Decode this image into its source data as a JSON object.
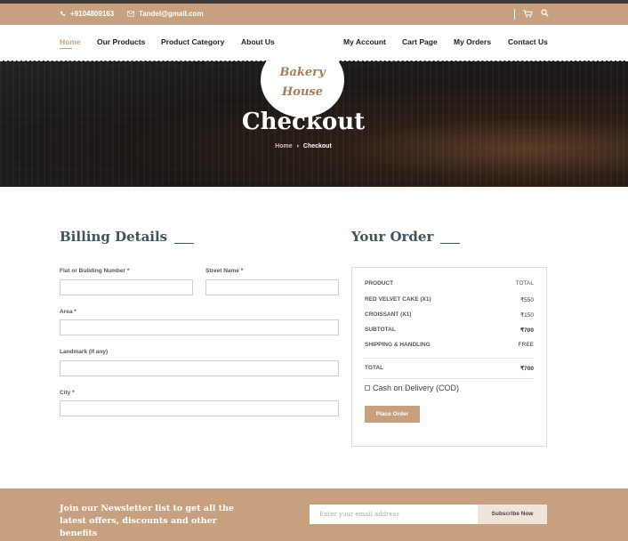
{
  "topbar": {
    "phone": "+9104809163",
    "email": "Tandel@gmail.com",
    "icons": [
      "phone-icon",
      "mail-icon",
      "cart-icon",
      "search-icon"
    ]
  },
  "nav": {
    "items": [
      "Home",
      "Our Products",
      "Product Category",
      "About Us",
      "My Account",
      "Cart Page",
      "My Orders",
      "Contact Us"
    ],
    "active": "Home"
  },
  "logo": {
    "line1": "Bakery",
    "line2": "House"
  },
  "hero": {
    "title": "Checkout",
    "breadcrumb": {
      "home": "Home",
      "separator": "›",
      "current": "Checkout"
    }
  },
  "billing": {
    "title": "Billing Details",
    "fields": [
      {
        "label": "Flat or Building Number *",
        "value": ""
      },
      {
        "label": "Street Name *",
        "value": ""
      },
      {
        "label": "Area *",
        "value": ""
      },
      {
        "label": "Landmark (If any)",
        "value": ""
      },
      {
        "label": "City *",
        "value": ""
      }
    ]
  },
  "order": {
    "title": "Your Order",
    "header": {
      "product": "PRODUCT",
      "total": "TOTAL"
    },
    "items": [
      {
        "name": "RED VELVET CAKE (X1)",
        "price": "₹550"
      },
      {
        "name": "CROISSANT (X1)",
        "price": "₹150"
      }
    ],
    "subtotal": {
      "label": "SUBTOTAL",
      "value": "₹700"
    },
    "shipping": {
      "label": "SHIPPING & HANDLING",
      "value": "FREE"
    },
    "total": {
      "label": "TOTAL",
      "value": "₹700"
    },
    "payment_option": "Cash on Delivery (COD)",
    "place_order": "Place Order"
  },
  "newsletter": {
    "text": "Join our Newsletter list to get all the latest offers, discounts and other benefits",
    "placeholder": "Enter your email address",
    "button": "Subscribe Now"
  },
  "colors": {
    "accent": "#c7a17f",
    "heading": "#3e5560",
    "hero_dark": "#1a1715"
  }
}
